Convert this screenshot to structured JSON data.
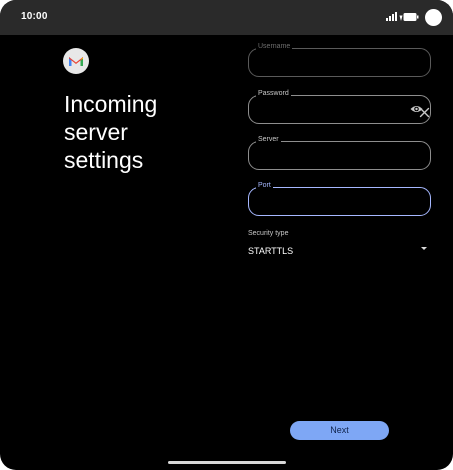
{
  "status": {
    "time": "10:00",
    "icons": [
      "signal-icon",
      "wifi-icon",
      "battery-icon"
    ]
  },
  "logo": {
    "name": "gmail-logo-icon",
    "colors": {
      "red": "#ea4335",
      "blue": "#4285f4",
      "green": "#34a853",
      "yellow": "#fbbc05"
    }
  },
  "heading": {
    "line1": "Incoming",
    "line2": "server",
    "line3": "settings"
  },
  "fields": {
    "username": {
      "label": "Username",
      "value": ""
    },
    "password": {
      "label": "Password",
      "value": ""
    },
    "server": {
      "label": "Server",
      "value": ""
    },
    "port": {
      "label": "Port",
      "value": ""
    }
  },
  "security": {
    "label": "Security type",
    "value": "STARTTLS"
  },
  "actions": {
    "next_label": "Next"
  },
  "colors": {
    "accent": "#7ea7f5",
    "focus": "#a6b8ff",
    "background": "#000000"
  }
}
